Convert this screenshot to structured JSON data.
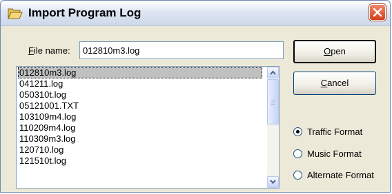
{
  "window": {
    "title": "Import Program Log",
    "icon": "folder-open-icon",
    "close_icon": "close-icon"
  },
  "file_name": {
    "label_underlined": "F",
    "label_rest": "ile name:",
    "value": "012810m3.log"
  },
  "file_list": {
    "items": [
      {
        "name": "012810m3.log",
        "selected": true
      },
      {
        "name": "041211.log",
        "selected": false
      },
      {
        "name": "050310t.log",
        "selected": false
      },
      {
        "name": "05121001.TXT",
        "selected": false
      },
      {
        "name": "103109m4.log",
        "selected": false
      },
      {
        "name": "110209m4.log",
        "selected": false
      },
      {
        "name": "110309m3.log",
        "selected": false
      },
      {
        "name": "120710.log",
        "selected": false
      },
      {
        "name": "121510t.log",
        "selected": false
      }
    ]
  },
  "buttons": {
    "open_underlined": "O",
    "open_rest": "pen",
    "cancel_underlined": "C",
    "cancel_rest": "ancel"
  },
  "format_options": [
    {
      "label": "Traffic Format",
      "checked": true
    },
    {
      "label": "Music Format",
      "checked": false
    },
    {
      "label": "Alternate Format",
      "checked": false
    }
  ]
}
